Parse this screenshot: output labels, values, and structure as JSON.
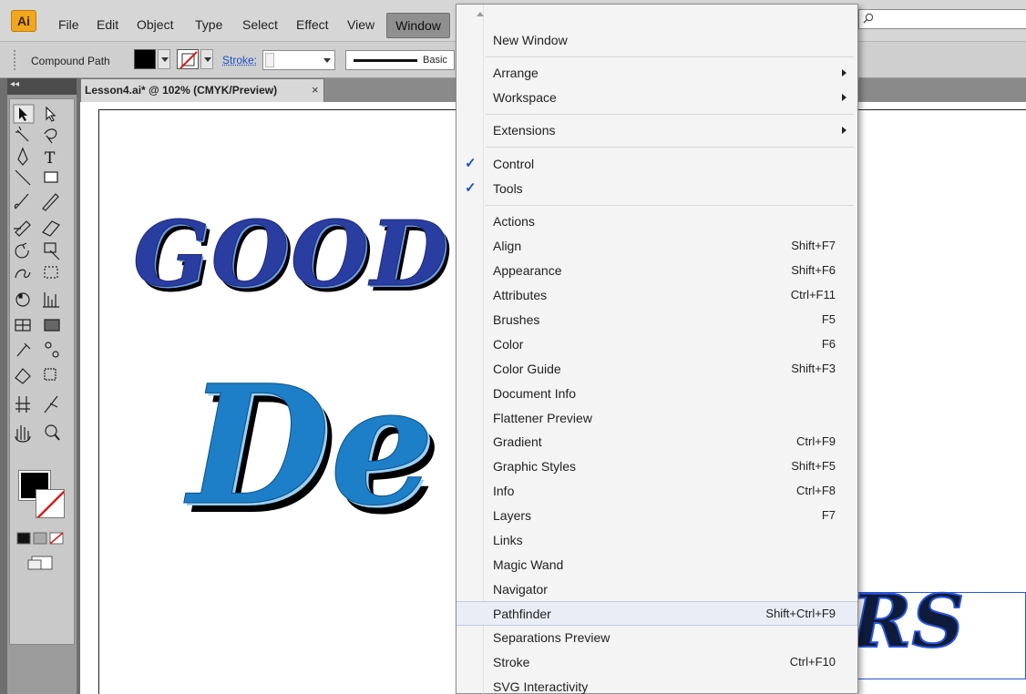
{
  "menubar": {
    "app_logo": "Ai",
    "items": [
      "File",
      "Edit",
      "Object",
      "Type",
      "Select",
      "Effect",
      "View",
      "Window"
    ]
  },
  "control_bar": {
    "selection_type": "Compound Path",
    "stroke_label": "Stroke:",
    "brush": "Basic"
  },
  "document_tab": {
    "title": "Lesson4.ai* @ 102% (CMYK/Preview)",
    "close": "×"
  },
  "canvas": {
    "good_text": "GOOD",
    "de_text": "De",
    "rs_text": "RS"
  },
  "window_menu": {
    "items": [
      {
        "label": "New Window",
        "shortcut": "",
        "submenu": false,
        "checked": false
      },
      {
        "label": "Arrange",
        "shortcut": "",
        "submenu": true,
        "checked": false
      },
      {
        "label": "Workspace",
        "shortcut": "",
        "submenu": true,
        "checked": false
      },
      {
        "label": "Extensions",
        "shortcut": "",
        "submenu": true,
        "checked": false
      },
      {
        "label": "Control",
        "shortcut": "",
        "submenu": false,
        "checked": true
      },
      {
        "label": "Tools",
        "shortcut": "",
        "submenu": false,
        "checked": true
      },
      {
        "label": "Actions",
        "shortcut": "",
        "submenu": false,
        "checked": false
      },
      {
        "label": "Align",
        "shortcut": "Shift+F7",
        "submenu": false,
        "checked": false
      },
      {
        "label": "Appearance",
        "shortcut": "Shift+F6",
        "submenu": false,
        "checked": false
      },
      {
        "label": "Attributes",
        "shortcut": "Ctrl+F11",
        "submenu": false,
        "checked": false
      },
      {
        "label": "Brushes",
        "shortcut": "F5",
        "submenu": false,
        "checked": false
      },
      {
        "label": "Color",
        "shortcut": "F6",
        "submenu": false,
        "checked": false
      },
      {
        "label": "Color Guide",
        "shortcut": "Shift+F3",
        "submenu": false,
        "checked": false
      },
      {
        "label": "Document Info",
        "shortcut": "",
        "submenu": false,
        "checked": false
      },
      {
        "label": "Flattener Preview",
        "shortcut": "",
        "submenu": false,
        "checked": false
      },
      {
        "label": "Gradient",
        "shortcut": "Ctrl+F9",
        "submenu": false,
        "checked": false
      },
      {
        "label": "Graphic Styles",
        "shortcut": "Shift+F5",
        "submenu": false,
        "checked": false
      },
      {
        "label": "Info",
        "shortcut": "Ctrl+F8",
        "submenu": false,
        "checked": false
      },
      {
        "label": "Layers",
        "shortcut": "F7",
        "submenu": false,
        "checked": false
      },
      {
        "label": "Links",
        "shortcut": "",
        "submenu": false,
        "checked": false
      },
      {
        "label": "Magic Wand",
        "shortcut": "",
        "submenu": false,
        "checked": false
      },
      {
        "label": "Navigator",
        "shortcut": "",
        "submenu": false,
        "checked": false
      },
      {
        "label": "Pathfinder",
        "shortcut": "Shift+Ctrl+F9",
        "submenu": false,
        "checked": false,
        "highlighted": true
      },
      {
        "label": "Separations Preview",
        "shortcut": "",
        "submenu": false,
        "checked": false
      },
      {
        "label": "Stroke",
        "shortcut": "Ctrl+F10",
        "submenu": false,
        "checked": false
      },
      {
        "label": "SVG Interactivity",
        "shortcut": "",
        "submenu": false,
        "checked": false
      }
    ],
    "check_glyph": "✓"
  },
  "colors": {
    "accent_menu_highlight": "#e9edf6",
    "check": "#1a52b8",
    "good_text": "#2a3ea1",
    "de_text": "#1d7fc8"
  },
  "icons": [
    "selection-tool",
    "direct-selection-tool",
    "magic-wand",
    "lasso",
    "pen",
    "type",
    "line",
    "rectangle",
    "paintbrush",
    "pencil",
    "blob-brush",
    "eraser",
    "rotate",
    "scale",
    "warp",
    "free-transform",
    "symbol-sprayer",
    "column-graph",
    "mesh",
    "gradient",
    "eyedropper",
    "blend",
    "live-paint-bucket",
    "live-paint-selection",
    "artboard",
    "slice",
    "hand",
    "zoom"
  ]
}
